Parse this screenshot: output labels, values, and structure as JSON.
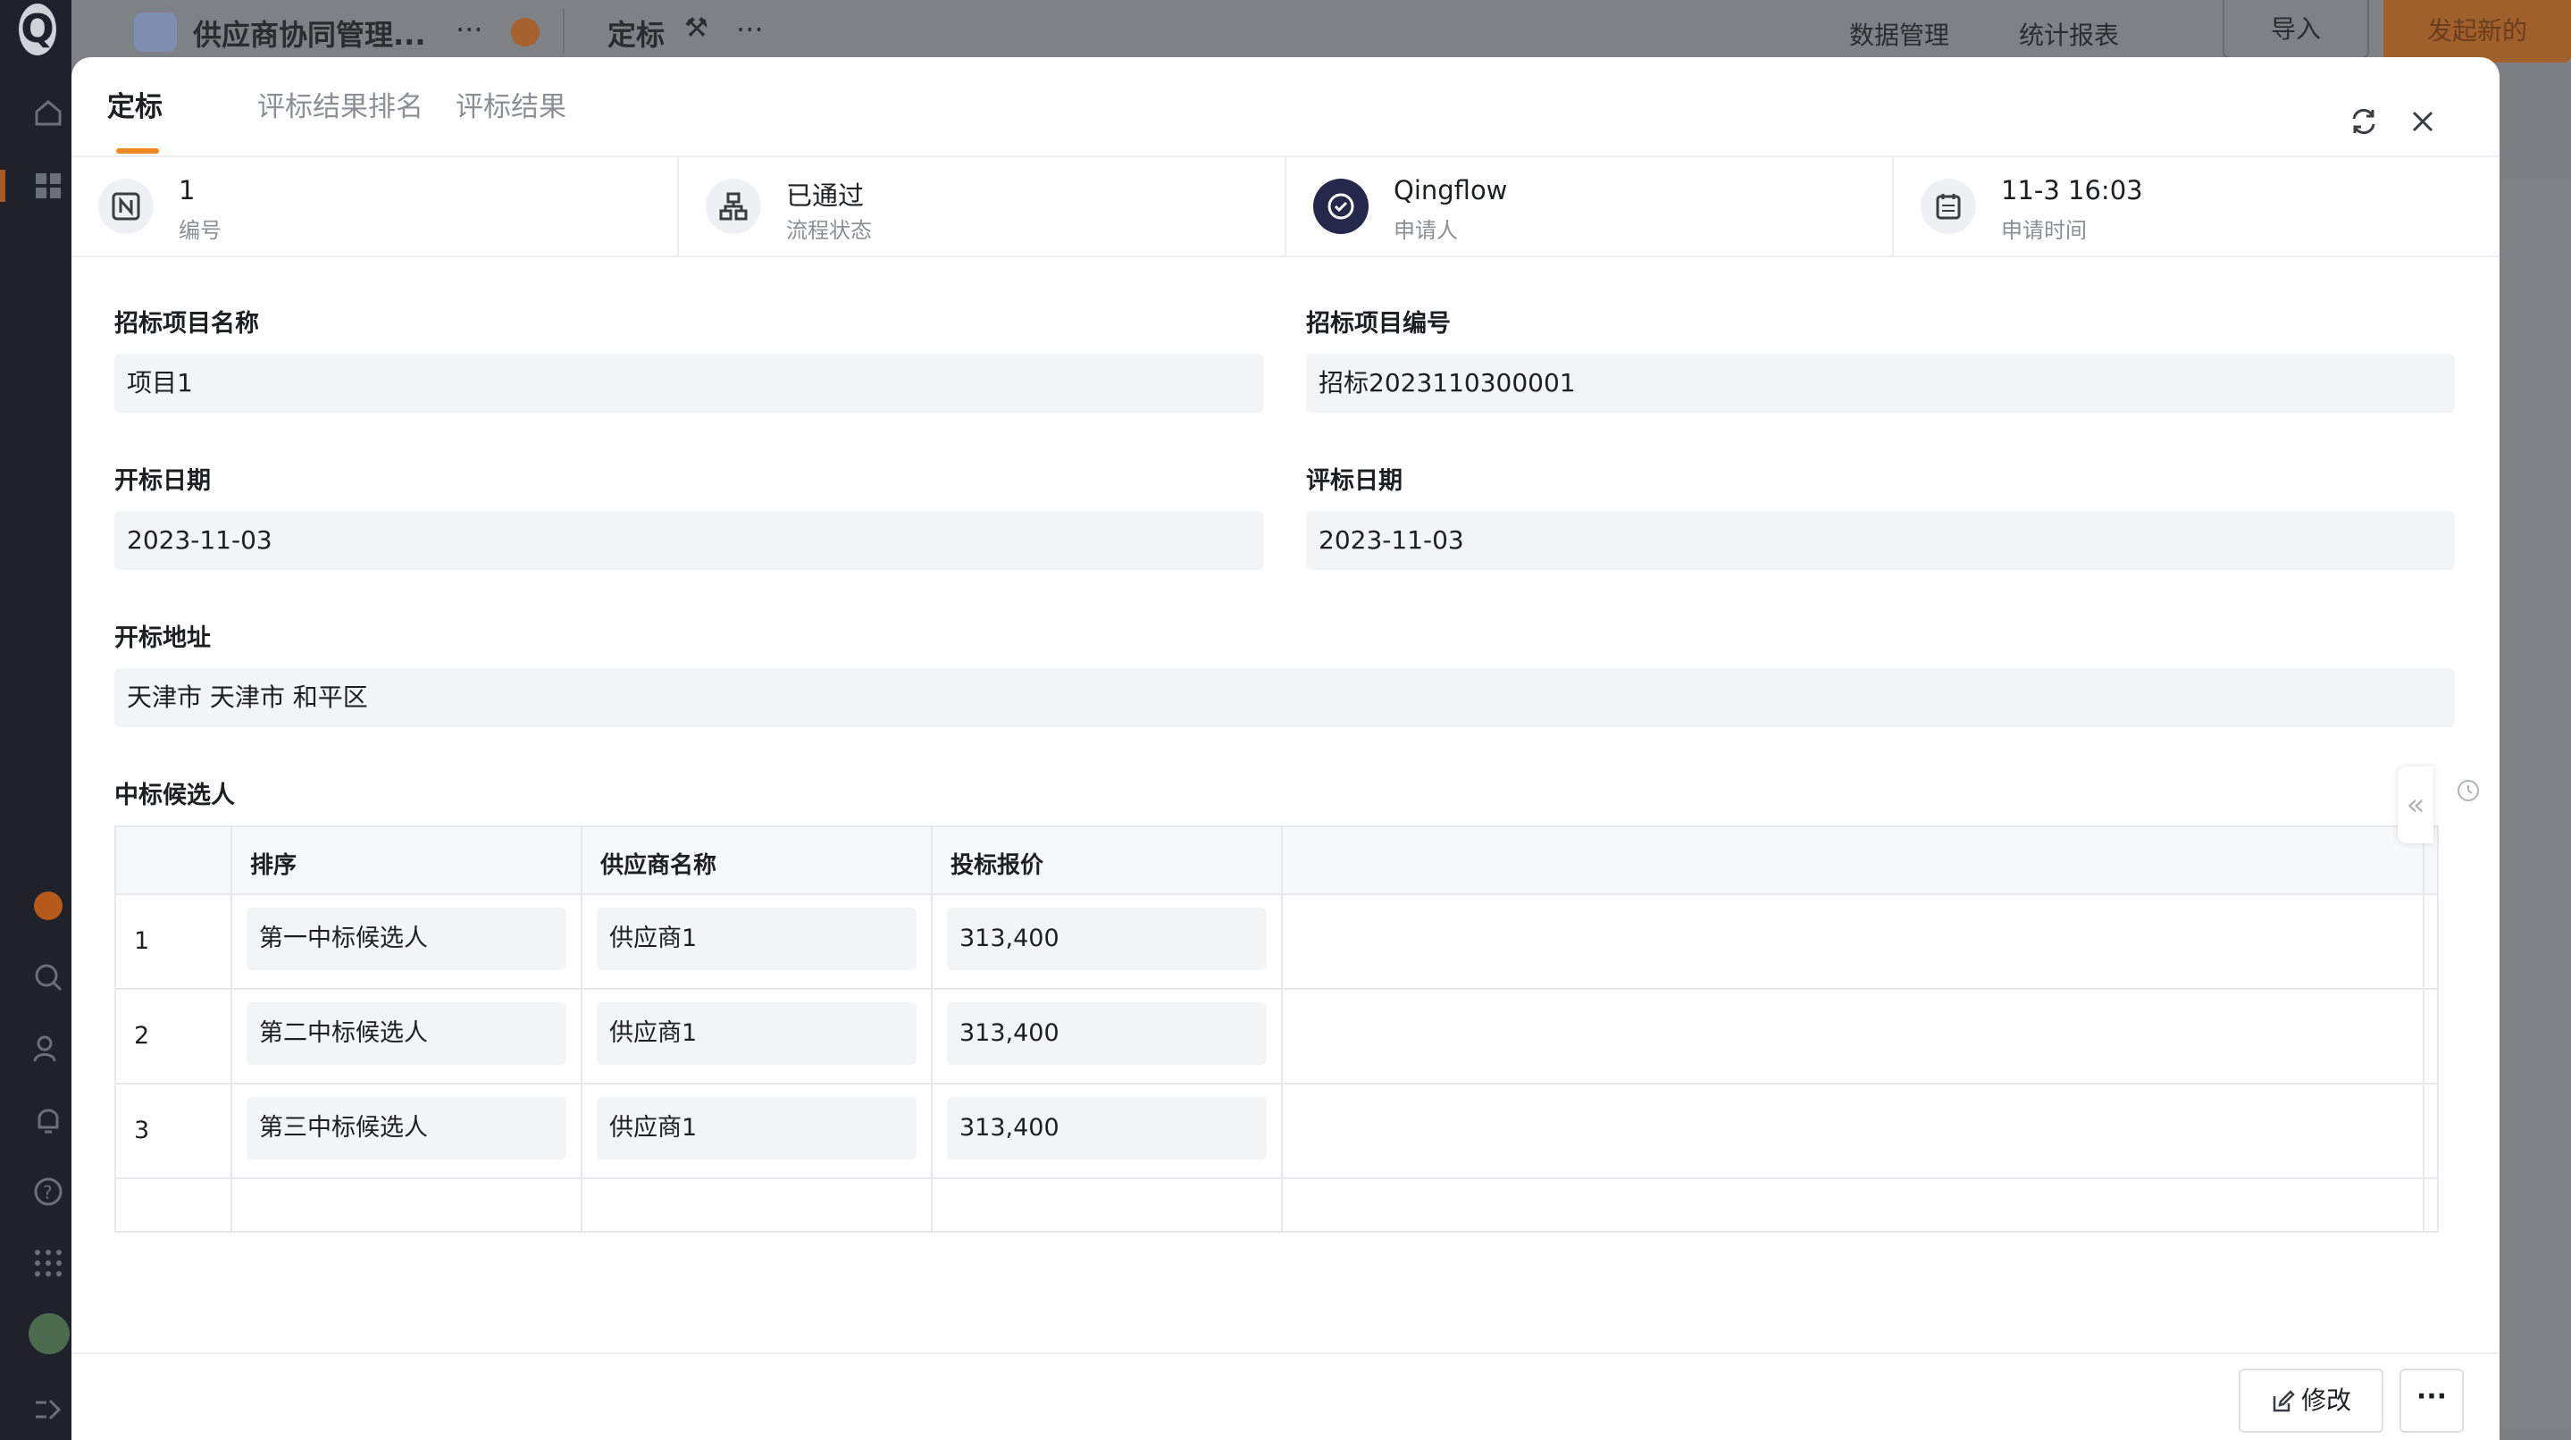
{
  "app": {
    "logo_letter": "Q",
    "app_title": "供应商协同管理...",
    "form_title": "定标",
    "data_mgmt": "数据管理",
    "stats": "统计报表",
    "import": "导入",
    "new": "发起新的"
  },
  "modal": {
    "tabs": [
      "定标",
      "评标结果排名",
      "评标结果"
    ],
    "info": [
      {
        "value": "1",
        "label": "编号",
        "icon": "number-icon"
      },
      {
        "value": "已通过",
        "label": "流程状态",
        "icon": "workflow-icon"
      },
      {
        "value": "Qingflow",
        "label": "申请人",
        "icon": "applicant-avatar-icon"
      },
      {
        "value": "11-3 16:03",
        "label": "申请时间",
        "icon": "calendar-icon"
      }
    ],
    "fields": {
      "project_name": {
        "label": "招标项目名称",
        "value": "项目1"
      },
      "project_no": {
        "label": "招标项目编号",
        "value": "招标2023110300001"
      },
      "open_date": {
        "label": "开标日期",
        "value": "2023-11-03"
      },
      "eval_date": {
        "label": "评标日期",
        "value": "2023-11-03"
      },
      "open_address": {
        "label": "开标地址",
        "value": "天津市 天津市 和平区"
      }
    },
    "candidates": {
      "label": "中标候选人",
      "headers": [
        "排序",
        "供应商名称",
        "投标报价"
      ],
      "rows": [
        {
          "idx": "1",
          "rank": "第一中标候选人",
          "supplier": "供应商1",
          "price": "313,400"
        },
        {
          "idx": "2",
          "rank": "第二中标候选人",
          "supplier": "供应商1",
          "price": "313,400"
        },
        {
          "idx": "3",
          "rank": "第三中标候选人",
          "supplier": "供应商1",
          "price": "313,400"
        }
      ]
    },
    "footer": {
      "edit_label": "修改",
      "more_label": "···"
    },
    "collapse_glyph": "«"
  },
  "colors": {
    "accent": "#f08a24",
    "text": "#1d1f23",
    "muted": "#8c8f94",
    "field_bg": "#f3f4f5"
  }
}
